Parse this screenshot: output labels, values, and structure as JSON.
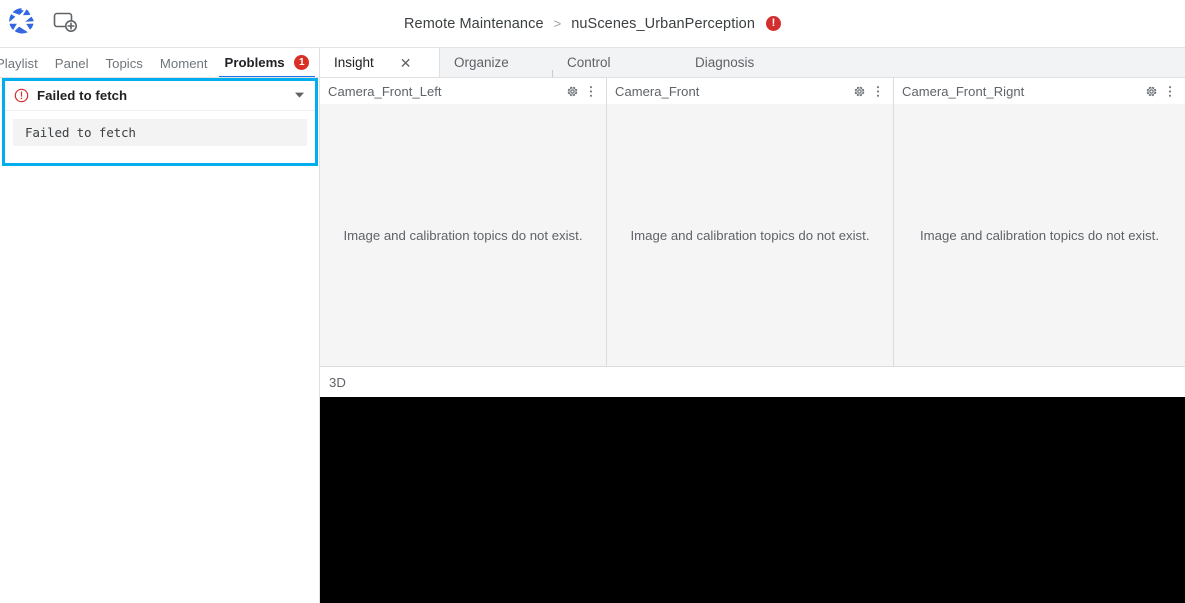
{
  "header": {
    "logo_icon": "aperture-logo-icon",
    "add_panel_icon": "add-panel-icon",
    "breadcrumb": {
      "root": "Remote Maintenance",
      "separator": ">",
      "current": "nuScenes_UrbanPerception",
      "error_badge": "!",
      "error_badge_color": "#d32f2f"
    }
  },
  "left_panel": {
    "tabs": [
      {
        "label": "Playlist",
        "active": false
      },
      {
        "label": "Panel",
        "active": false
      },
      {
        "label": "Topics",
        "active": false
      },
      {
        "label": "Moment",
        "active": false
      },
      {
        "label": "Problems",
        "active": true,
        "badge": "1"
      }
    ],
    "close_icon": "close-icon",
    "accent_color": "#1a73e8",
    "badge_color": "#d93025",
    "highlight_color": "#00aeef",
    "problems": [
      {
        "title": "Failed to fetch",
        "severity_icon": "error-circle-icon",
        "severity_color": "#d32f2f",
        "expanded": true,
        "chevron_icon": "chevron-down-icon",
        "detail": "Failed to fetch"
      }
    ]
  },
  "right_panel": {
    "tabs": [
      {
        "label": "Insight",
        "active": true,
        "closable": true
      },
      {
        "label": "Organize",
        "active": false,
        "closable": false
      },
      {
        "label": "Control",
        "active": false,
        "closable": false
      },
      {
        "label": "Diagnosis",
        "active": false,
        "closable": false
      }
    ],
    "close_icon": "close-icon",
    "cameras": [
      {
        "title": "Camera_Front_Left",
        "empty_message": "Image and calibration topics do not exist.",
        "settings_icon": "gear-icon",
        "menu_icon": "more-vertical-icon"
      },
      {
        "title": "Camera_Front",
        "empty_message": "Image and calibration topics do not exist.",
        "settings_icon": "gear-icon",
        "menu_icon": "more-vertical-icon"
      },
      {
        "title": "Camera_Front_Rignt",
        "empty_message": "Image and calibration topics do not exist.",
        "settings_icon": "gear-icon",
        "menu_icon": "more-vertical-icon"
      }
    ],
    "viewport": {
      "title": "3D",
      "background_color": "#000000"
    }
  }
}
